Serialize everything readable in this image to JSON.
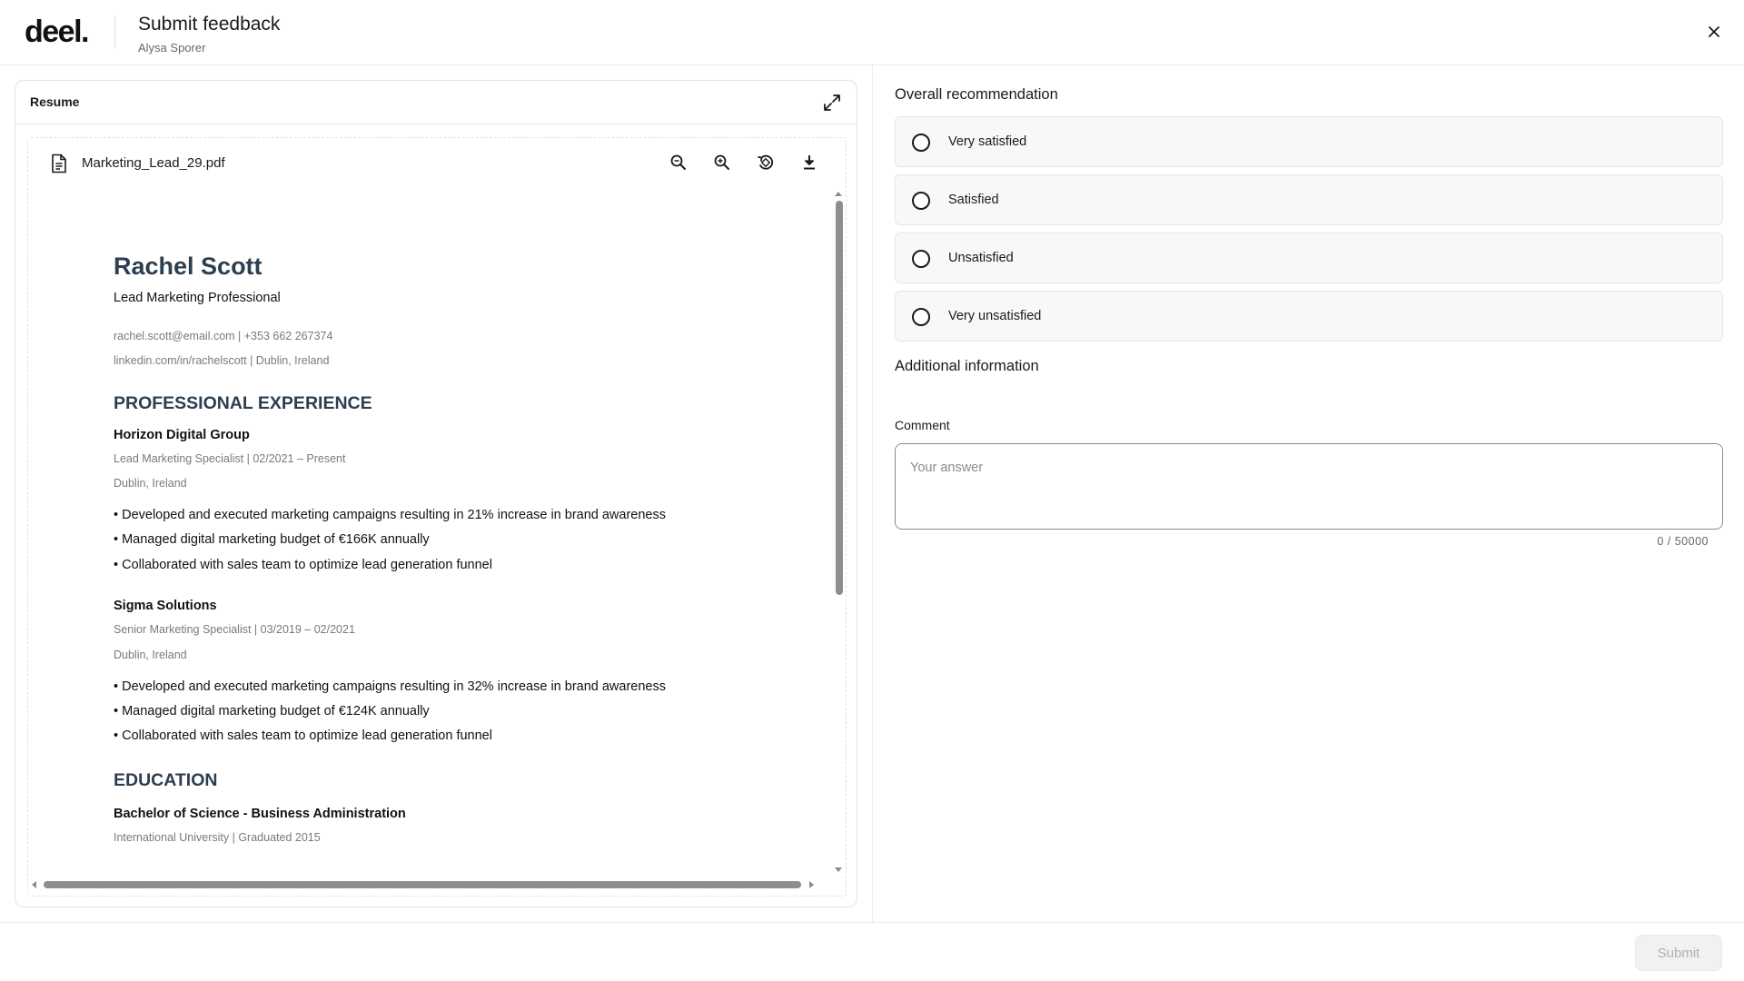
{
  "header": {
    "logo": "deel.",
    "title": "Submit feedback",
    "subtitle": "Alysa Sporer"
  },
  "resume": {
    "card_title": "Resume",
    "file_name": "Marketing_Lead_29.pdf",
    "document": {
      "name": "Rachel Scott",
      "role": "Lead Marketing Professional",
      "contact_line_1": "rachel.scott@email.com | +353 662 267374",
      "contact_line_2": "linkedin.com/in/rachelscott | Dublin, Ireland",
      "experience_heading": "PROFESSIONAL EXPERIENCE",
      "jobs": [
        {
          "company": "Horizon Digital Group",
          "position": "Lead Marketing Specialist | 02/2021 – Present",
          "location": "Dublin, Ireland",
          "bullets": [
            "• Developed and executed marketing campaigns resulting in 21% increase in brand awareness",
            "• Managed digital marketing budget of €166K annually",
            "• Collaborated with sales team to optimize lead generation funnel"
          ]
        },
        {
          "company": "Sigma Solutions",
          "position": "Senior Marketing Specialist | 03/2019 – 02/2021",
          "location": "Dublin, Ireland",
          "bullets": [
            "• Developed and executed marketing campaigns resulting in 32% increase in brand awareness",
            "• Managed digital marketing budget of €124K annually",
            "• Collaborated with sales team to optimize lead generation funnel"
          ]
        }
      ],
      "education_heading": "EDUCATION",
      "degree": "Bachelor of Science - Business Administration",
      "school": "International University | Graduated 2015"
    }
  },
  "feedback": {
    "recommendation_heading": "Overall recommendation",
    "options": [
      {
        "label": "Very satisfied"
      },
      {
        "label": "Satisfied"
      },
      {
        "label": "Unsatisfied"
      },
      {
        "label": "Very unsatisfied"
      }
    ],
    "additional_heading": "Additional information",
    "comment_label": "Comment",
    "comment_value": "",
    "comment_placeholder": "Your answer",
    "char_count": "0 / 50000"
  },
  "footer": {
    "submit_label": "Submit"
  },
  "icons": [
    "close-icon",
    "expand-icon",
    "file-icon",
    "zoom-out-icon",
    "zoom-in-icon",
    "rotate-icon",
    "download-icon"
  ]
}
